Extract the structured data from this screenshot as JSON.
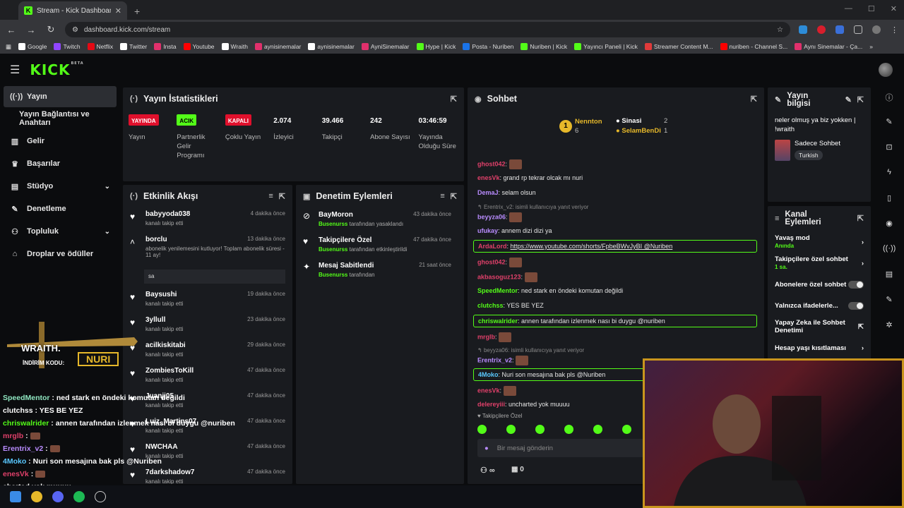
{
  "browser": {
    "tab_title": "Stream - Kick Dashboard",
    "url": "dashboard.kick.com/stream",
    "bookmarks": [
      "Google",
      "Twitch",
      "Netflix",
      "Twitter",
      "Insta",
      "Youtube",
      "Wraith",
      "aynisinemalar",
      "aynisinemalar",
      "AyniSinemalar",
      "Hype | Kick",
      "Posta - Nuriben",
      "Nuriben | Kick",
      "Yayıncı Paneli | Kick",
      "Streamer Content M...",
      "nuriben - Channel S...",
      "Aynı Sinemalar - Ça..."
    ]
  },
  "brand": {
    "logo": "KICK",
    "beta": "BETA",
    "accent": "#53fc18"
  },
  "sidebar": {
    "items": [
      {
        "label": "Yayın",
        "icon": "broadcast-icon"
      },
      {
        "label": "Yayın Bağlantısı ve Anahtarı",
        "icon": ""
      },
      {
        "label": "Gelir",
        "icon": "chart-icon"
      },
      {
        "label": "Başarılar",
        "icon": "trophy-icon"
      },
      {
        "label": "Stüdyo",
        "icon": "studio-icon"
      },
      {
        "label": "Denetleme",
        "icon": "wrench-icon"
      },
      {
        "label": "Topluluk",
        "icon": "community-icon"
      },
      {
        "label": "Droplar ve ödüller",
        "icon": "gift-icon"
      }
    ]
  },
  "stats": {
    "title": "Yayın İstatistikleri",
    "items": [
      {
        "badge": "YAYINDA",
        "label": "Yayın"
      },
      {
        "badge": "ACIK",
        "label": "Partnerlik Gelir Programı"
      },
      {
        "badge": "KAPALI",
        "label": "Çoklu Yayın"
      },
      {
        "value": "2.074",
        "label": "İzleyici"
      },
      {
        "value": "39.466",
        "label": "Takipçi"
      },
      {
        "value": "242",
        "label": "Abone Sayısı"
      },
      {
        "value": "03:46:59",
        "label": "Yayında Olduğu Süre"
      }
    ]
  },
  "activity": {
    "title": "Etkinlik Akışı",
    "items": [
      {
        "name": "babyyoda038",
        "text": "kanalı takip etti",
        "time": "4 dakika önce"
      },
      {
        "name": "borclu",
        "text": "abonelik yenilemesini kutluyor! Toplam abonelik süresi - 11 ay!",
        "time": "13 dakika önce",
        "message": "sa"
      },
      {
        "name": "Baysushi",
        "text": "kanalı takip etti",
        "time": "19 dakika önce"
      },
      {
        "name": "3yllull",
        "text": "kanalı takip etti",
        "time": "23 dakika önce"
      },
      {
        "name": "acilkiskitabi",
        "text": "kanalı takip etti",
        "time": "29 dakika önce"
      },
      {
        "name": "ZombiesToKill",
        "text": "kanalı takip etti",
        "time": "47 dakika önce"
      },
      {
        "name": "Juanjj05",
        "text": "kanalı takip etti",
        "time": "47 dakika önce"
      },
      {
        "name": "Luiz_Martins07",
        "text": "kanalı takip etti",
        "time": "47 dakika önce"
      },
      {
        "name": "NWCHAA",
        "text": "kanalı takip etti",
        "time": "47 dakika önce"
      },
      {
        "name": "7darkshadow7",
        "text": "kanalı takip etti",
        "time": "47 dakika önce"
      }
    ]
  },
  "moderation": {
    "title": "Denetim Eylemleri",
    "items": [
      {
        "name": "BayMoron",
        "by": "Busenurss",
        "text": "tarafından yasaklandı",
        "time": "43 dakika önce"
      },
      {
        "name": "Takipçilere Özel",
        "by": "Busenurss",
        "text": "tarafından etkinleştirildi",
        "time": "47 dakika önce"
      },
      {
        "name": "Mesaj Sabitlendi",
        "by": "Busenurss",
        "text": "tarafından",
        "time": "21 saat önce"
      }
    ]
  },
  "chat": {
    "title": "Sohbet",
    "leaderboard": [
      {
        "rank": "1",
        "name": "Nennton",
        "count": "6"
      },
      {
        "name": "Sinasi",
        "count": "2"
      },
      {
        "name": "SelamBenDi",
        "count": "1"
      }
    ],
    "messages": [
      {
        "user": "ghost042",
        "color": "#e0406a",
        "text": ""
      },
      {
        "user": "enesVk",
        "color": "#e0406a",
        "text": "grand rp tekrar olcak mı nuri"
      },
      {
        "user": "DemaJ",
        "color": "#b98cff",
        "text": "selam olsun"
      },
      {
        "reply": "Erentrix_v2: isimli kullanıcıya yanıt veriyor"
      },
      {
        "user": "beyyza06",
        "color": "#b98cff",
        "text": ""
      },
      {
        "user": "ufukay",
        "color": "#b98cff",
        "text": "annem dizi dizi ya"
      },
      {
        "user": "ArdaLord",
        "color": "#e0406a",
        "text": "https://www.youtube.com/shorts/FpbeBWvJyBI @Nuriben",
        "highlight": true
      },
      {
        "user": "ghost042",
        "color": "#e0406a",
        "text": ""
      },
      {
        "user": "akbasoguz123",
        "color": "#e0406a",
        "text": ""
      },
      {
        "user": "SpeedMentor",
        "color": "#53fc18",
        "text": "ned stark en öndeki komutan değildi"
      },
      {
        "user": "clutchss",
        "color": "#53fc18",
        "text": "YES BE YEZ"
      },
      {
        "user": "chriswalrider",
        "color": "#53fc18",
        "text": "annen tarafından izlenmek nası bi duygu @nuriben",
        "highlight": true
      },
      {
        "user": "mrglb",
        "color": "#e0406a",
        "text": ""
      },
      {
        "reply": "beyyza06: isimli kullanıcıya yanıt veriyor"
      },
      {
        "user": "Erentrix_v2",
        "color": "#b98cff",
        "text": ""
      },
      {
        "user": "4Moko",
        "color": "#5ac8ff",
        "text": "Nuri son mesajına bak pls @Nuriben",
        "highlight": true
      },
      {
        "user": "enesVk",
        "color": "#e0406a",
        "text": ""
      },
      {
        "user": "delereyiii",
        "color": "#e0406a",
        "text": "uncharted yok muuuu"
      }
    ],
    "followers_only": "Takipçilere Özel",
    "input_placeholder": "Bir mesaj gönderin",
    "viewers": "∞",
    "counter": "0"
  },
  "info": {
    "title": "Yayın bilgisi",
    "stream_title": "neler olmuş ya biz yokken | !wraith",
    "category": "Sadece Sohbet",
    "tag": "Turkish"
  },
  "channel": {
    "title": "Kanal Eylemleri",
    "items": [
      {
        "label": "Yavaş mod",
        "sub": "Anında",
        "type": "chevron"
      },
      {
        "label": "Takipçilere özel sohbet",
        "sub": "1 sa.",
        "type": "chevron"
      },
      {
        "label": "Abonelere özel sohbet",
        "type": "toggle"
      },
      {
        "label": "Yalnızca ifadelerle...",
        "type": "toggle"
      },
      {
        "label": "Yapay Zeka ile Sohbet Denetimi",
        "type": "link"
      },
      {
        "label": "Hesap yaşı kısıtlaması",
        "type": "chevron"
      }
    ]
  },
  "overlay": {
    "wraith_brand": "WRAITH.",
    "wraith_code_label": "İNDİRİM KODU:",
    "wraith_code": "NURI",
    "chat": [
      {
        "user": "SpeedMentor",
        "text": "ned stark en öndeki komutan değildi",
        "color": "#8fe6c0"
      },
      {
        "user": "clutchss",
        "text": "YES BE YEZ",
        "color": "#ffffff"
      },
      {
        "user": "chriswalrider",
        "text": "annen tarafından izlenmek nası bi duygu @nuriben",
        "color": "#53fc18"
      },
      {
        "user": "mrglb",
        "text": "",
        "color": "#e0406a"
      },
      {
        "user": "Erentrix_v2",
        "text": "",
        "color": "#b98cff"
      },
      {
        "user": "4Moko",
        "text": "Nuri son mesajına bak pls @Nuriben",
        "color": "#5ac8ff"
      },
      {
        "user": "enesVk",
        "text": "",
        "color": "#e0406a"
      },
      {
        "user": "",
        "text": "charted yok muuuu",
        "color": "#ffffff"
      }
    ]
  }
}
